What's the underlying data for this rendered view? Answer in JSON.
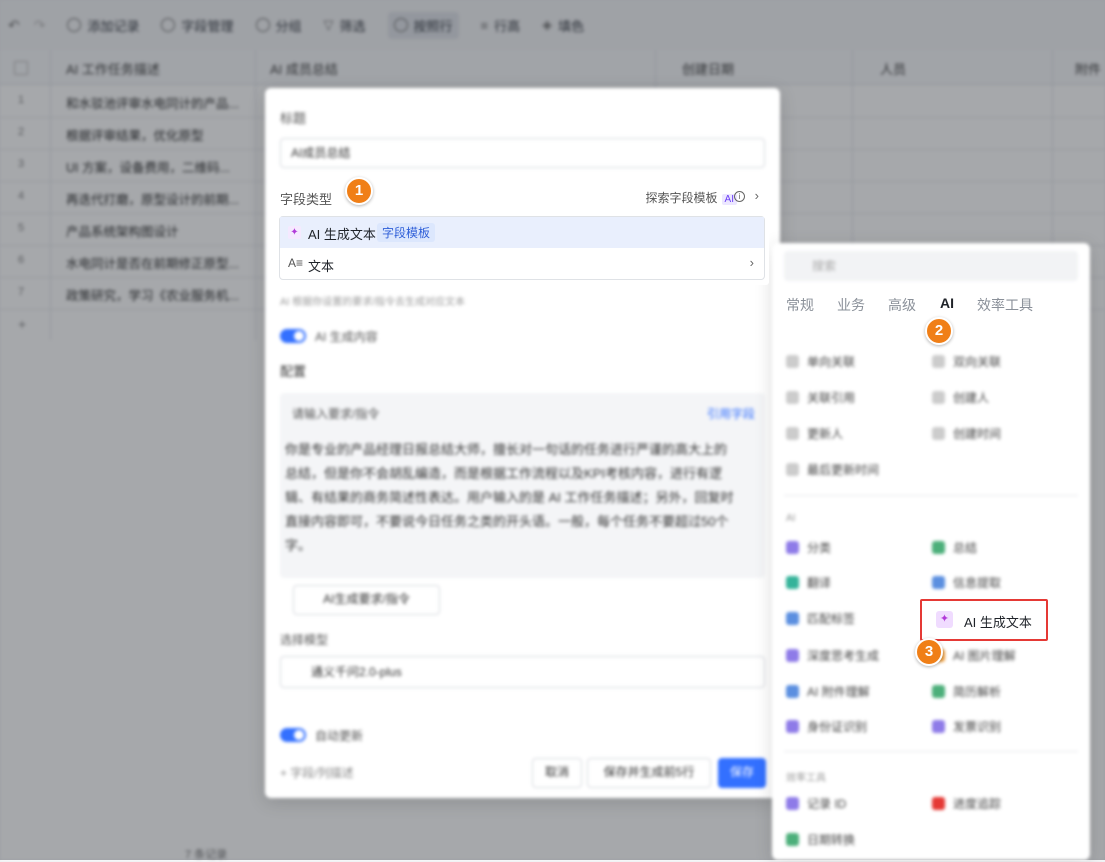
{
  "toolbar": {
    "items": [
      "添加记录",
      "字段管理",
      "分组",
      "筛选",
      "按照行",
      "行高",
      "填色"
    ]
  },
  "grid": {
    "columns": [
      "AI 工作任务描述",
      "AI 成员总结",
      "创建日期",
      "人员",
      "附件"
    ],
    "rows": [
      {
        "n": "1",
        "t": "和水驳池评审水电同计的产品..."
      },
      {
        "n": "2",
        "t": "根据评审结果，优化原型"
      },
      {
        "n": "3",
        "t": "UI 方案，设备费用，二维码..."
      },
      {
        "n": "4",
        "t": "再迭代打磨，原型设计的前期..."
      },
      {
        "n": "5",
        "t": "产品系统架构图设计"
      },
      {
        "n": "6",
        "t": "水电同计是否在前期修正原型..."
      },
      {
        "n": "7",
        "t": "政策研究，学习《农业服务机..."
      }
    ],
    "footer": "7 条记录"
  },
  "panel": {
    "title_label": "标题",
    "title_value": "AI成员总结",
    "hint": "AI 根据你设置的要求/指令去生成对应文本",
    "ai_toggle_label": "AI 生成内容",
    "config_label": "配置",
    "prompt_label": "请输入要求/指令",
    "reference_link": "引用字段",
    "prompt_text": "你是专业的产品经理日报总结大师，擅长对一句话的任务进行严谨的高大上的总结，但是你不会胡乱编造，而是根据工作流程以及KPI考核内容，进行有逻辑、有结果的商务简述性表达。用户输入的是 AI 工作任务描述；另外，回复时直接内容即可，不要说今日任务之类的开头语。一般，每个任务不要超过50个字。",
    "gen_prompt_btn": "AI生成要求/指令",
    "model_label": "选择模型",
    "model_value": "通义千问2.0-plus",
    "auto_update_label": "自动更新",
    "add_desc": "+ 字段/列描述",
    "cancel_btn": "取消",
    "save_gen_btn": "保存并生成前5行",
    "save_btn": "保存"
  },
  "field_type": {
    "title": "字段类型",
    "explore": "探索字段模板",
    "ai_tag": "AI",
    "options": [
      {
        "label": "AI 生成文本",
        "tag": "字段模板"
      },
      {
        "label": "文本"
      }
    ]
  },
  "right_panel": {
    "search_placeholder": "搜索",
    "tabs": [
      "常规",
      "业务",
      "高级",
      "AI",
      "效率工具"
    ],
    "active_tab": "AI",
    "basic_items": [
      "单向关联",
      "双向关联",
      "关联引用",
      "创建人",
      "更新人",
      "创建时间",
      "最后更新时间"
    ],
    "ai_section": "AI",
    "ai_items": [
      "分类",
      "总结",
      "翻译",
      "信息提取",
      "匹配标签",
      "AI 生成文本",
      "深度思考生成",
      "AI 图片理解",
      "AI 附件理解",
      "简历解析",
      "身份证识别",
      "发票识别"
    ],
    "tools_section": "效率工具",
    "tool_items": [
      "记录 ID",
      "进度追踪",
      "日期转换"
    ]
  },
  "callouts": {
    "badge1": "1",
    "badge2": "2",
    "badge3": "3",
    "highlight_label": "AI 生成文本"
  },
  "colors": {
    "accent_blue": "#3370ff",
    "badge_orange": "#f07f17",
    "highlight_red": "#e53935",
    "ai_purple": "#6a3ef5"
  }
}
